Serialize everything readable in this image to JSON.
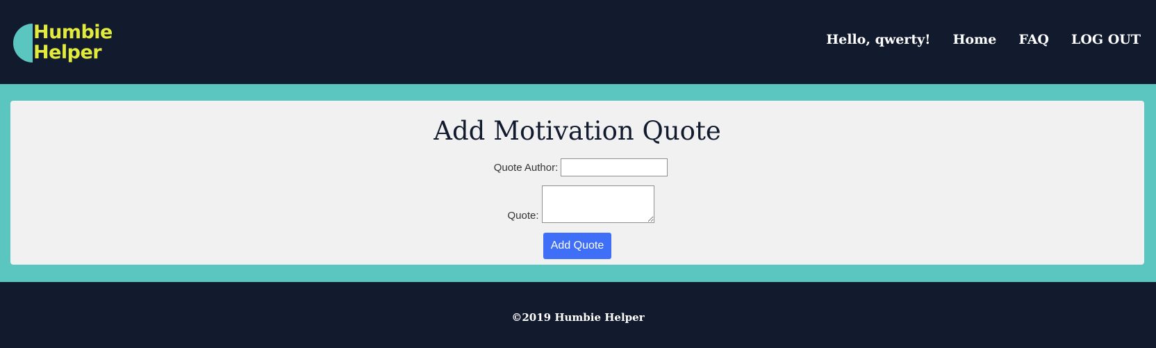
{
  "header": {
    "logo": {
      "line1": "Humbie",
      "line2": "Helper"
    },
    "nav": {
      "greeting": "Hello, qwerty!",
      "home": "Home",
      "faq": "FAQ",
      "logout": "LOG OUT"
    }
  },
  "main": {
    "title": "Add Motivation Quote",
    "author_label": "Quote Author:",
    "author_value": "",
    "quote_label": "Quote:",
    "quote_value": "",
    "submit_label": "Add Quote"
  },
  "footer": {
    "copyright": "©2019 Humbie Helper"
  },
  "colors": {
    "navy": "#121b2d",
    "teal": "#5bc6c0",
    "logo_yellow": "#e2eb3b",
    "card": "#f1f1f1",
    "button_blue": "#3f6ff7"
  }
}
